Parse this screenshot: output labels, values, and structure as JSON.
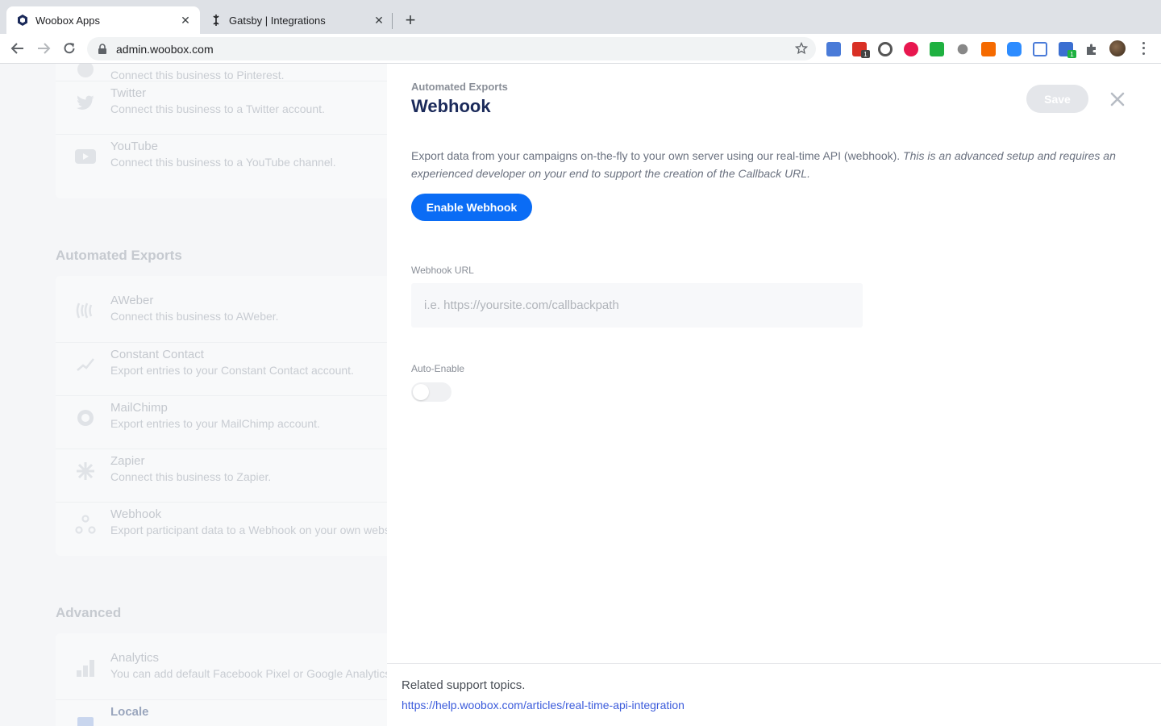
{
  "browser": {
    "tabs": [
      {
        "title": "Woobox Apps",
        "active": true
      },
      {
        "title": "Gatsby | Integrations",
        "active": false
      }
    ],
    "url": "admin.woobox.com",
    "extension_badges": [
      "1",
      "1"
    ]
  },
  "background": {
    "social_items": [
      {
        "name": "",
        "desc": "Connect this business to Pinterest.",
        "icon": "pinterest-icon"
      },
      {
        "name": "Twitter",
        "desc": "Connect this business to a Twitter account.",
        "icon": "twitter-icon"
      },
      {
        "name": "YouTube",
        "desc": "Connect this business to a YouTube channel.",
        "icon": "youtube-icon"
      }
    ],
    "automated_exports_title": "Automated Exports",
    "export_items": [
      {
        "name": "AWeber",
        "desc": "Connect this business to AWeber.",
        "icon": "aweber-icon"
      },
      {
        "name": "Constant Contact",
        "desc": "Export entries to your Constant Contact account.",
        "icon": "constant-contact-icon"
      },
      {
        "name": "MailChimp",
        "desc": "Export entries to your MailChimp account.",
        "icon": "mailchimp-icon"
      },
      {
        "name": "Zapier",
        "desc": "Connect this business to Zapier.",
        "icon": "zapier-icon"
      },
      {
        "name": "Webhook",
        "desc": "Export participant data to a Webhook on your own webs",
        "icon": "webhook-icon"
      }
    ],
    "advanced_title": "Advanced",
    "advanced_items": [
      {
        "name": "Analytics",
        "desc": "You can add default Facebook Pixel or Google Analytics",
        "icon": "analytics-icon"
      },
      {
        "name": "Locale",
        "desc": "",
        "icon": "locale-icon"
      }
    ]
  },
  "panel": {
    "eyebrow": "Automated Exports",
    "title": "Webhook",
    "save_label": "Save",
    "intro_plain": "Export data from your campaigns on-the-fly to your own server using our real-time API (webhook). ",
    "intro_italic": "This is an advanced setup and requires an experienced developer on your end to support the creation of the Callback URL.",
    "enable_label": "Enable Webhook",
    "webhook_url_label": "Webhook URL",
    "webhook_url_placeholder": "i.e. https://yoursite.com/callbackpath",
    "webhook_url_value": "",
    "auto_enable_label": "Auto-Enable",
    "auto_enable_on": false
  },
  "footer": {
    "related_title": "Related support topics.",
    "related_link": "https://help.woobox.com/articles/real-time-api-integration"
  },
  "colors": {
    "primary": "#0a6cf5",
    "title": "#1b2a5a",
    "link": "#3b5bdb"
  }
}
